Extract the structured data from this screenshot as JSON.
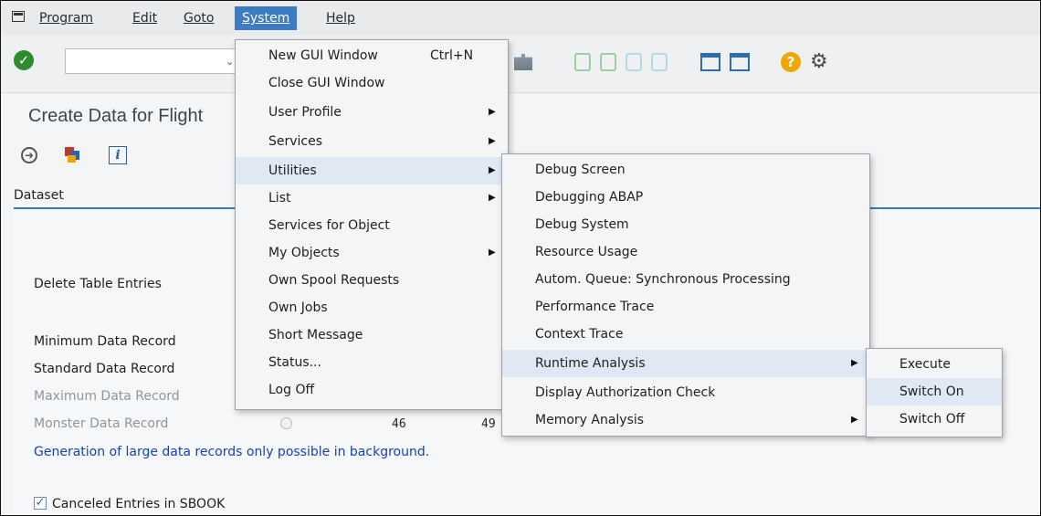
{
  "menubar": {
    "items": [
      "Program",
      "Edit",
      "Goto",
      "System",
      "Help"
    ]
  },
  "title": "Create Data for Flight",
  "dataset_tab": "Dataset",
  "form": {
    "delete_label": "Delete Table Entries",
    "minimum_label": "Minimum Data Record",
    "standard_label": "Standard Data Record",
    "maximum_label": "Maximum Data Record",
    "monster_label": "Monster Data Record",
    "monster_value_1": "46",
    "monster_value_2": "49",
    "background_note": "Generation of large data records only possible in background.",
    "canceled_label": "Canceled Entries in SBOOK"
  },
  "system_menu": {
    "items": [
      {
        "label": "New GUI Window",
        "shortcut": "Ctrl+N"
      },
      {
        "label": "Close GUI Window"
      },
      {
        "label": "User Profile",
        "submenu": true
      },
      {
        "label": "Services",
        "submenu": true
      },
      {
        "label": "Utilities",
        "submenu": true,
        "highlighted": true
      },
      {
        "label": "List",
        "submenu": true
      },
      {
        "label": "Services for Object"
      },
      {
        "label": "My Objects",
        "submenu": true
      },
      {
        "label": "Own Spool Requests"
      },
      {
        "label": "Own Jobs"
      },
      {
        "label": "Short Message"
      },
      {
        "label": "Status..."
      },
      {
        "label": "Log Off"
      }
    ]
  },
  "utilities_menu": {
    "items": [
      {
        "label": "Debug Screen"
      },
      {
        "label": "Debugging ABAP"
      },
      {
        "label": "Debug System"
      },
      {
        "label": "Resource Usage"
      },
      {
        "label": "Autom. Queue: Synchronous Processing"
      },
      {
        "label": "Performance Trace"
      },
      {
        "label": "Context Trace"
      },
      {
        "label": "Runtime Analysis",
        "submenu": true,
        "highlighted": true
      },
      {
        "label": "Display Authorization Check"
      },
      {
        "label": "Memory Analysis",
        "submenu": true
      }
    ]
  },
  "runtime_menu": {
    "items": [
      {
        "label": "Execute"
      },
      {
        "label": "Switch On",
        "highlighted": true
      },
      {
        "label": "Switch Off"
      }
    ]
  },
  "colors": {
    "menu_active": "#3d7cc2",
    "highlight": "#dfe8f3",
    "accent_line": "#2d7fb8",
    "note_text": "#1540c0"
  }
}
